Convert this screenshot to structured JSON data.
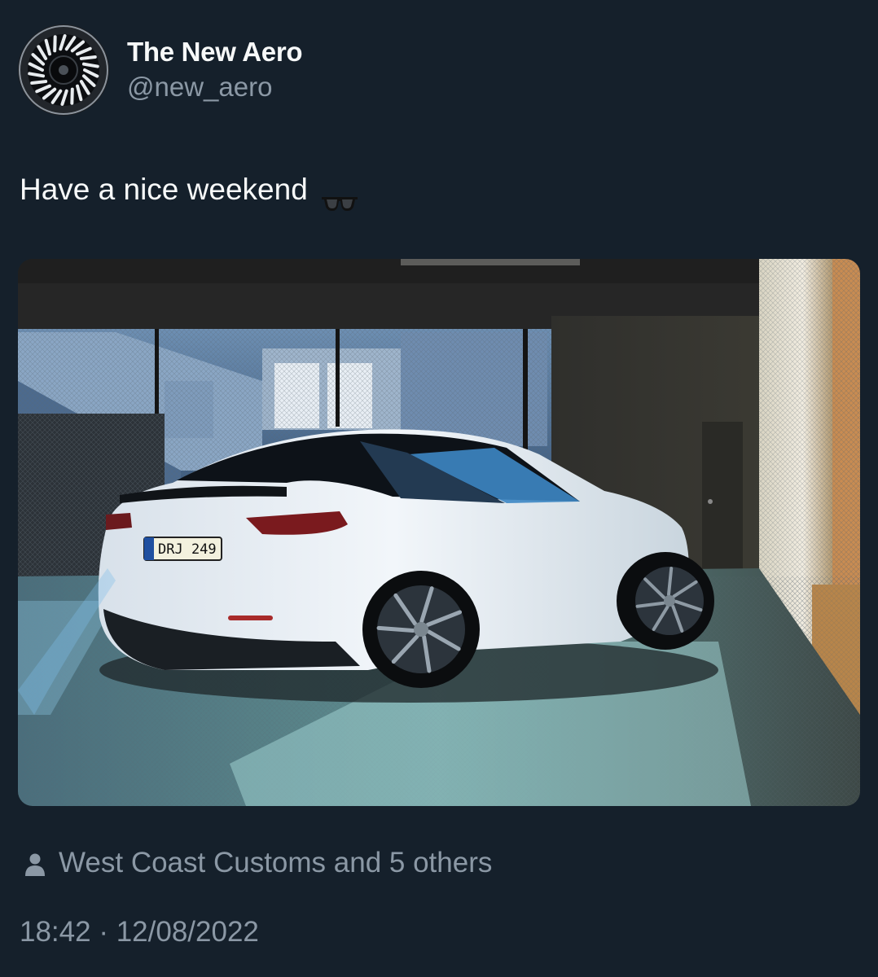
{
  "author": {
    "display_name": "The New Aero",
    "handle": "@new_aero",
    "avatar_icon": "wheel-avatar-icon"
  },
  "tweet": {
    "text": "Have a nice weekend",
    "emoji_icon": "sunglasses-icon"
  },
  "media": {
    "plate_text": "DRJ 249"
  },
  "tagged": {
    "icon": "person-icon",
    "text": "West Coast Customs and 5 others"
  },
  "meta": {
    "time": "18:42",
    "separator": "·",
    "date": "12/08/2022"
  },
  "colors": {
    "background": "#15202b",
    "primary_text": "#f7f9f9",
    "secondary_text": "#8b98a5"
  }
}
